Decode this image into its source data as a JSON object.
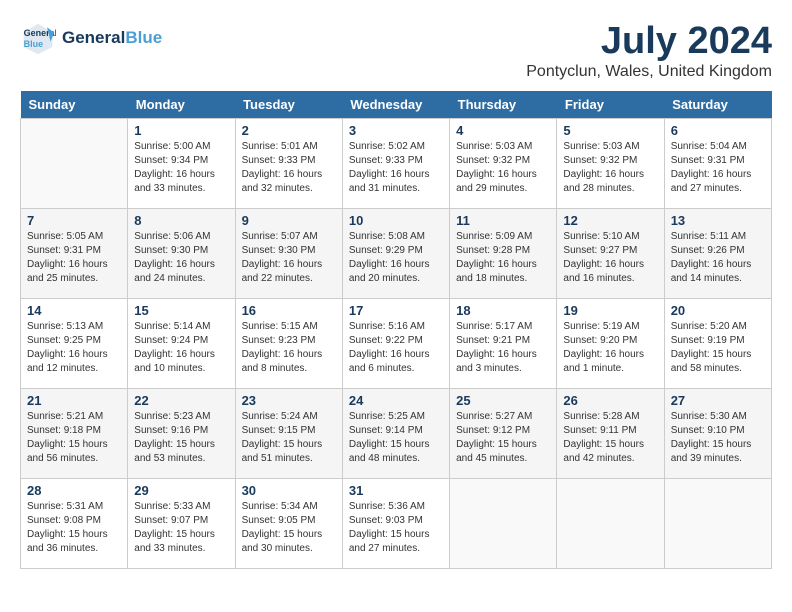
{
  "logo": {
    "text_general": "General",
    "text_blue": "Blue"
  },
  "title": "July 2024",
  "location": "Pontyclun, Wales, United Kingdom",
  "weekdays": [
    "Sunday",
    "Monday",
    "Tuesday",
    "Wednesday",
    "Thursday",
    "Friday",
    "Saturday"
  ],
  "weeks": [
    [
      {
        "day": "",
        "sunrise": "",
        "sunset": "",
        "daylight": ""
      },
      {
        "day": "1",
        "sunrise": "Sunrise: 5:00 AM",
        "sunset": "Sunset: 9:34 PM",
        "daylight": "Daylight: 16 hours and 33 minutes."
      },
      {
        "day": "2",
        "sunrise": "Sunrise: 5:01 AM",
        "sunset": "Sunset: 9:33 PM",
        "daylight": "Daylight: 16 hours and 32 minutes."
      },
      {
        "day": "3",
        "sunrise": "Sunrise: 5:02 AM",
        "sunset": "Sunset: 9:33 PM",
        "daylight": "Daylight: 16 hours and 31 minutes."
      },
      {
        "day": "4",
        "sunrise": "Sunrise: 5:03 AM",
        "sunset": "Sunset: 9:32 PM",
        "daylight": "Daylight: 16 hours and 29 minutes."
      },
      {
        "day": "5",
        "sunrise": "Sunrise: 5:03 AM",
        "sunset": "Sunset: 9:32 PM",
        "daylight": "Daylight: 16 hours and 28 minutes."
      },
      {
        "day": "6",
        "sunrise": "Sunrise: 5:04 AM",
        "sunset": "Sunset: 9:31 PM",
        "daylight": "Daylight: 16 hours and 27 minutes."
      }
    ],
    [
      {
        "day": "7",
        "sunrise": "Sunrise: 5:05 AM",
        "sunset": "Sunset: 9:31 PM",
        "daylight": "Daylight: 16 hours and 25 minutes."
      },
      {
        "day": "8",
        "sunrise": "Sunrise: 5:06 AM",
        "sunset": "Sunset: 9:30 PM",
        "daylight": "Daylight: 16 hours and 24 minutes."
      },
      {
        "day": "9",
        "sunrise": "Sunrise: 5:07 AM",
        "sunset": "Sunset: 9:30 PM",
        "daylight": "Daylight: 16 hours and 22 minutes."
      },
      {
        "day": "10",
        "sunrise": "Sunrise: 5:08 AM",
        "sunset": "Sunset: 9:29 PM",
        "daylight": "Daylight: 16 hours and 20 minutes."
      },
      {
        "day": "11",
        "sunrise": "Sunrise: 5:09 AM",
        "sunset": "Sunset: 9:28 PM",
        "daylight": "Daylight: 16 hours and 18 minutes."
      },
      {
        "day": "12",
        "sunrise": "Sunrise: 5:10 AM",
        "sunset": "Sunset: 9:27 PM",
        "daylight": "Daylight: 16 hours and 16 minutes."
      },
      {
        "day": "13",
        "sunrise": "Sunrise: 5:11 AM",
        "sunset": "Sunset: 9:26 PM",
        "daylight": "Daylight: 16 hours and 14 minutes."
      }
    ],
    [
      {
        "day": "14",
        "sunrise": "Sunrise: 5:13 AM",
        "sunset": "Sunset: 9:25 PM",
        "daylight": "Daylight: 16 hours and 12 minutes."
      },
      {
        "day": "15",
        "sunrise": "Sunrise: 5:14 AM",
        "sunset": "Sunset: 9:24 PM",
        "daylight": "Daylight: 16 hours and 10 minutes."
      },
      {
        "day": "16",
        "sunrise": "Sunrise: 5:15 AM",
        "sunset": "Sunset: 9:23 PM",
        "daylight": "Daylight: 16 hours and 8 minutes."
      },
      {
        "day": "17",
        "sunrise": "Sunrise: 5:16 AM",
        "sunset": "Sunset: 9:22 PM",
        "daylight": "Daylight: 16 hours and 6 minutes."
      },
      {
        "day": "18",
        "sunrise": "Sunrise: 5:17 AM",
        "sunset": "Sunset: 9:21 PM",
        "daylight": "Daylight: 16 hours and 3 minutes."
      },
      {
        "day": "19",
        "sunrise": "Sunrise: 5:19 AM",
        "sunset": "Sunset: 9:20 PM",
        "daylight": "Daylight: 16 hours and 1 minute."
      },
      {
        "day": "20",
        "sunrise": "Sunrise: 5:20 AM",
        "sunset": "Sunset: 9:19 PM",
        "daylight": "Daylight: 15 hours and 58 minutes."
      }
    ],
    [
      {
        "day": "21",
        "sunrise": "Sunrise: 5:21 AM",
        "sunset": "Sunset: 9:18 PM",
        "daylight": "Daylight: 15 hours and 56 minutes."
      },
      {
        "day": "22",
        "sunrise": "Sunrise: 5:23 AM",
        "sunset": "Sunset: 9:16 PM",
        "daylight": "Daylight: 15 hours and 53 minutes."
      },
      {
        "day": "23",
        "sunrise": "Sunrise: 5:24 AM",
        "sunset": "Sunset: 9:15 PM",
        "daylight": "Daylight: 15 hours and 51 minutes."
      },
      {
        "day": "24",
        "sunrise": "Sunrise: 5:25 AM",
        "sunset": "Sunset: 9:14 PM",
        "daylight": "Daylight: 15 hours and 48 minutes."
      },
      {
        "day": "25",
        "sunrise": "Sunrise: 5:27 AM",
        "sunset": "Sunset: 9:12 PM",
        "daylight": "Daylight: 15 hours and 45 minutes."
      },
      {
        "day": "26",
        "sunrise": "Sunrise: 5:28 AM",
        "sunset": "Sunset: 9:11 PM",
        "daylight": "Daylight: 15 hours and 42 minutes."
      },
      {
        "day": "27",
        "sunrise": "Sunrise: 5:30 AM",
        "sunset": "Sunset: 9:10 PM",
        "daylight": "Daylight: 15 hours and 39 minutes."
      }
    ],
    [
      {
        "day": "28",
        "sunrise": "Sunrise: 5:31 AM",
        "sunset": "Sunset: 9:08 PM",
        "daylight": "Daylight: 15 hours and 36 minutes."
      },
      {
        "day": "29",
        "sunrise": "Sunrise: 5:33 AM",
        "sunset": "Sunset: 9:07 PM",
        "daylight": "Daylight: 15 hours and 33 minutes."
      },
      {
        "day": "30",
        "sunrise": "Sunrise: 5:34 AM",
        "sunset": "Sunset: 9:05 PM",
        "daylight": "Daylight: 15 hours and 30 minutes."
      },
      {
        "day": "31",
        "sunrise": "Sunrise: 5:36 AM",
        "sunset": "Sunset: 9:03 PM",
        "daylight": "Daylight: 15 hours and 27 minutes."
      },
      {
        "day": "",
        "sunrise": "",
        "sunset": "",
        "daylight": ""
      },
      {
        "day": "",
        "sunrise": "",
        "sunset": "",
        "daylight": ""
      },
      {
        "day": "",
        "sunrise": "",
        "sunset": "",
        "daylight": ""
      }
    ]
  ]
}
